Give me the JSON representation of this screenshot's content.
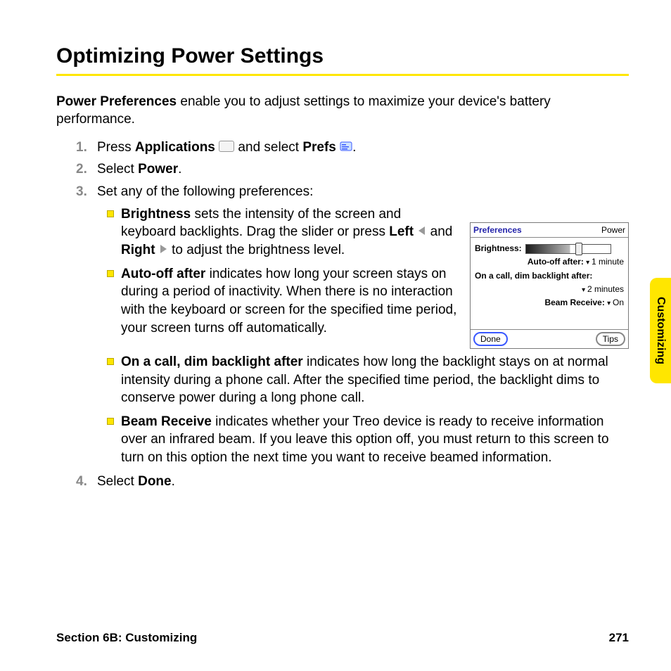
{
  "title": "Optimizing Power Settings",
  "intro": {
    "lead": "Power Preferences",
    "rest": " enable you to adjust settings to maximize your device's battery performance."
  },
  "steps": {
    "s1": {
      "pre": "Press ",
      "app": "Applications",
      "mid": " and select ",
      "prefs": "Prefs",
      "post": "."
    },
    "s2": {
      "pre": "Select ",
      "b": "Power",
      "post": "."
    }
  },
  "step3_lead": "Set any of the following preferences:",
  "bullets": {
    "brightness": {
      "term": "Brightness",
      "t1": " sets the intensity of the screen and keyboard backlights. Drag the slider or press ",
      "left": "Left",
      "t2": " and ",
      "right": "Right",
      "t3": " to adjust the brightness level."
    },
    "autooff": {
      "term": "Auto-off after",
      "text": " indicates how long your screen stays on during a period of inactivity. When there is no interaction with the keyboard or screen for the specified time period, your screen turns off automatically."
    },
    "oncall": {
      "term": "On a call, dim backlight after",
      "text": " indicates how long the backlight stays on at normal intensity during a phone call. After the specified time period, the backlight dims to conserve power during a long phone call."
    },
    "beam": {
      "term": "Beam Receive",
      "text": " indicates whether your Treo device is ready to receive information over an infrared beam. If you leave this option off, you must return to this screen to turn on this option the next time you want to receive beamed information."
    }
  },
  "step4": {
    "pre": "Select ",
    "b": "Done",
    "post": "."
  },
  "screenshot": {
    "title": "Preferences",
    "category": "Power",
    "brightness_label": "Brightness:",
    "autooff_label": "Auto-off after:",
    "autooff_value": "1 minute",
    "oncall_label": "On a call, dim backlight after:",
    "oncall_value": "2 minutes",
    "beam_label": "Beam Receive:",
    "beam_value": "On",
    "done": "Done",
    "tips": "Tips"
  },
  "side_tab": "Customizing",
  "footer": {
    "section": "Section 6B: Customizing",
    "page": "271"
  }
}
